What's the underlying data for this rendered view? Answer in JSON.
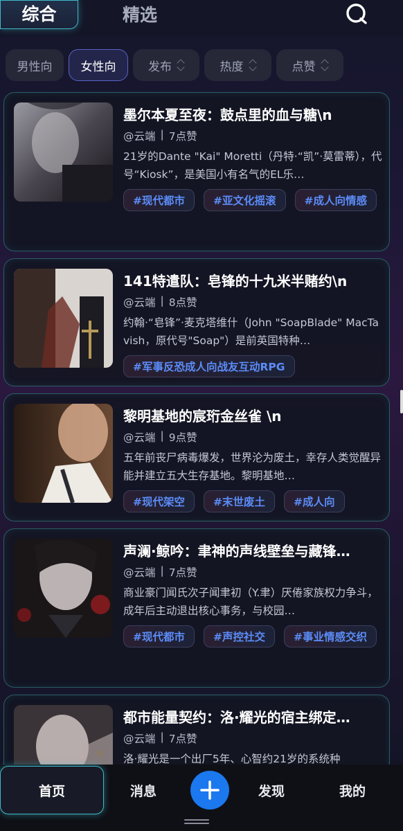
{
  "tabs": {
    "active": "综合",
    "inactive": "精选"
  },
  "filters": [
    {
      "label": "男性向",
      "active": false,
      "sortable": false
    },
    {
      "label": "女性向",
      "active": true,
      "sortable": false
    },
    {
      "label": "发布",
      "active": false,
      "sortable": true
    },
    {
      "label": "热度",
      "active": false,
      "sortable": true
    },
    {
      "label": "点赞",
      "active": false,
      "sortable": true
    }
  ],
  "cards": [
    {
      "title": "墨尔本夏至夜：鼓点里的血与糖\\n",
      "author": "@云端",
      "likes": "7点赞",
      "desc": "21岁的Dante \"Kai\" Moretti（丹特·“凯”·莫雷蒂），代号“Kiosk”，是美国小有名气的EL乐…",
      "tags": [
        "#现代都市",
        "#亚文化摇滚",
        "#成人向情感"
      ]
    },
    {
      "title": "141特遣队：皂锋的十九米半赌约\\n",
      "author": "@云端",
      "likes": "8点赞",
      "desc": "约翰·“皂锋”·麦克塔维什（John \"SoapBlade\" MacTavish，原代号\"Soap\"）是前英国特种…",
      "tags": [
        "#军事反恐成人向战友互动RPG"
      ]
    },
    {
      "title": "黎明基地的宸珩金丝雀 \\n",
      "author": "@云端",
      "likes": "9点赞",
      "desc": "五年前丧尸病毒爆发，世界沦为废土，幸存人类觉醒异能并建立五大生存基地。黎明基地…",
      "tags": [
        "#现代架空",
        "#末世废土",
        "#成人向"
      ]
    },
    {
      "title": "声澜·鲸吟：聿神的声线壁垒与藏锋…",
      "author": "@云端",
      "likes": "7点赞",
      "desc": "商业豪门闻氏次子闻聿初（Y.聿）厌倦家族权力争斗，成年后主动退出核心事务，与校园…",
      "tags": [
        "#现代都市",
        "#声控社交",
        "#事业情感交织"
      ]
    },
    {
      "title": "都市能量契约：洛·耀光的宿主绑定…",
      "author": "@云端",
      "likes": "7点赞",
      "desc": "洛·耀光是一个出厂5年、心智约21岁的系统种",
      "tags": []
    }
  ],
  "nav": {
    "home": "首页",
    "messages": "消息",
    "discover": "发现",
    "mine": "我的"
  },
  "colors": {
    "accent": "#3fb9c9",
    "tag_text": "#5b8cf7",
    "primary_button": "#1b78ef"
  }
}
